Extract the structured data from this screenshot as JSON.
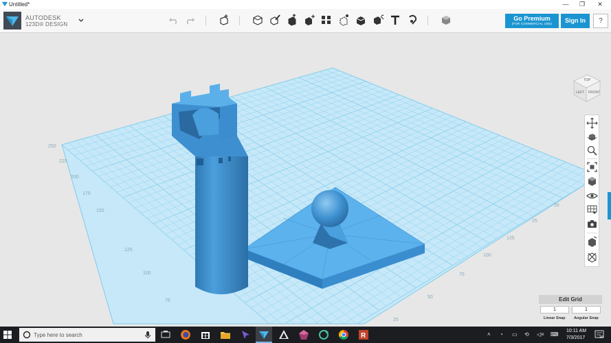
{
  "window": {
    "title": "Untitled*",
    "minimize": "—",
    "maximize": "❐",
    "close": "✕"
  },
  "brand": {
    "line1": "AUTODESK",
    "line2": "123D® DESIGN"
  },
  "toolbar": {
    "tools": [
      "undo",
      "redo",
      "add-primitive",
      "sketch",
      "construct",
      "modify",
      "pattern",
      "group",
      "combine",
      "measure",
      "text",
      "snap",
      "material"
    ],
    "premium_label": "Go Premium",
    "premium_sub": "(FOR COMMERCIAL USE)",
    "signin_label": "Sign In",
    "help_label": "?"
  },
  "viewcube": {
    "top": "TOP",
    "left": "LEFT",
    "front": "FRONT"
  },
  "grid": {
    "left_axis_labels": [
      "250",
      "225",
      "200",
      "175",
      "150",
      "125",
      "100",
      "75"
    ],
    "right_axis_labels": [
      "25",
      "50",
      "75",
      "100",
      "125"
    ],
    "right_axis_labels_far": [
      "25",
      "50"
    ]
  },
  "edit_grid": {
    "title": "Edit Grid",
    "linear_snap_value": "1",
    "angular_snap_value": "1",
    "linear_snap_label": "Linear Snap",
    "angular_snap_label": "Angular Snap"
  },
  "taskbar": {
    "search_placeholder": "Type here to search",
    "time": "10:11 AM",
    "date": "7/3/2017",
    "notifications": "30"
  },
  "colors": {
    "accent": "#1a95d1",
    "model_blue": "#4a9fdd",
    "grid_blue": "#c2e6f7",
    "grid_line": "#7fcbe9"
  }
}
